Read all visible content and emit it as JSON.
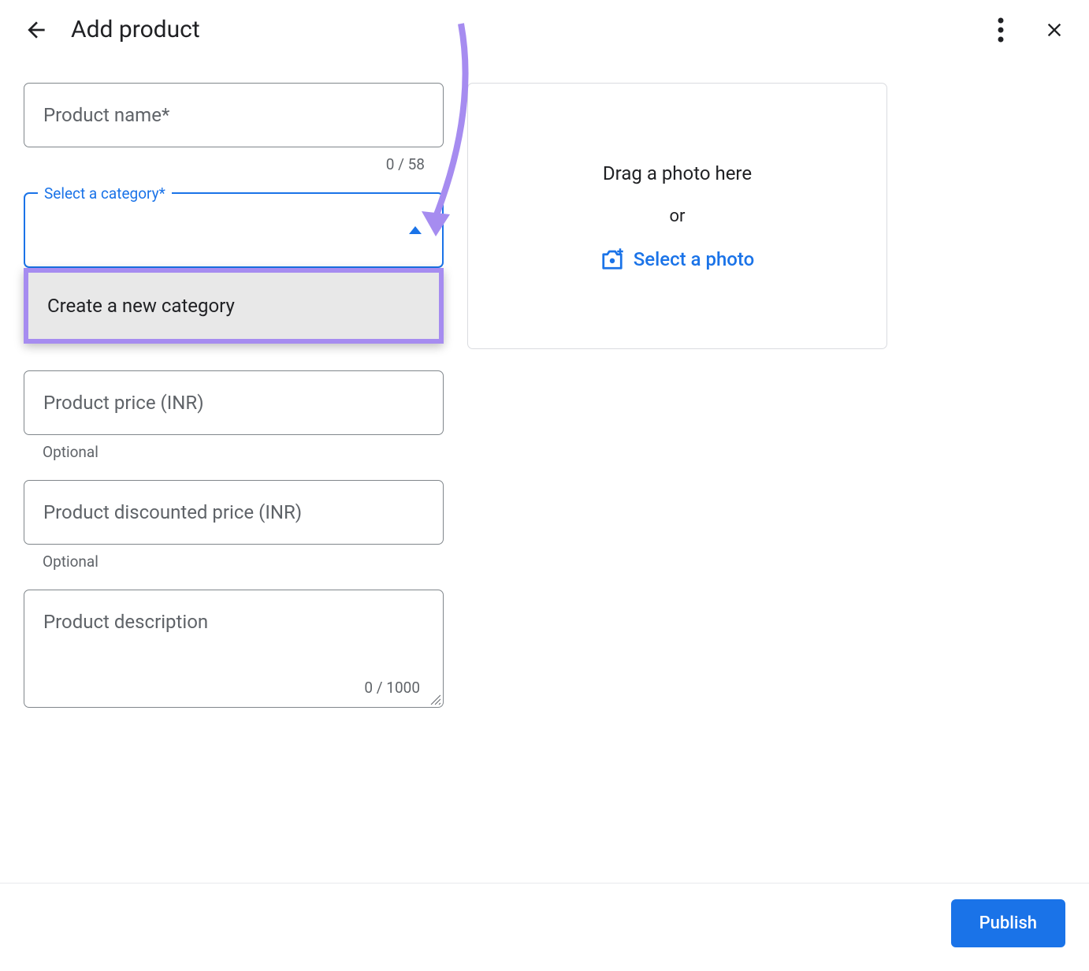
{
  "header": {
    "title": "Add product"
  },
  "productName": {
    "placeholder": "Product name*",
    "counter": "0 / 58"
  },
  "category": {
    "label": "Select a category*",
    "dropdownOption": "Create a new category"
  },
  "price": {
    "placeholder": "Product price (INR)",
    "helper": "Optional"
  },
  "discountedPrice": {
    "placeholder": "Product discounted price (INR)",
    "helper": "Optional"
  },
  "description": {
    "placeholder": "Product description",
    "counter": "0 / 1000"
  },
  "photoZone": {
    "dragText": "Drag a photo here",
    "orText": "or",
    "selectText": "Select a photo"
  },
  "footer": {
    "publishLabel": "Publish"
  }
}
